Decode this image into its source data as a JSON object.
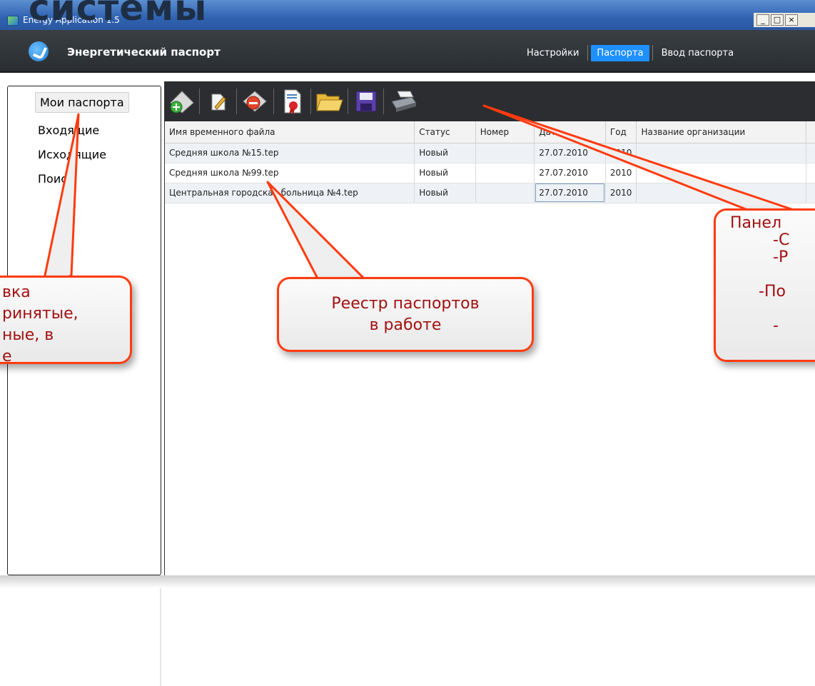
{
  "slide_title": "системы",
  "window": {
    "title": "Energy Application 1.5",
    "buttons": [
      "_",
      "□",
      "×"
    ]
  },
  "app": {
    "name": "Энергетический паспорт",
    "nav": [
      {
        "label": "Настройки",
        "active": false
      },
      {
        "label": "Паспорта",
        "active": true
      },
      {
        "label": "Ввод паспорта",
        "active": false
      }
    ]
  },
  "left_nav": {
    "items": [
      "Мои паспорта",
      "Входящие",
      "Исходящие",
      "Поиск"
    ],
    "selected": "Мои паспорта"
  },
  "toolbar": {
    "icons": [
      "add-icon",
      "edit-icon",
      "delete-icon",
      "certificate-icon",
      "open-folder-icon",
      "save-icon",
      "print-icon"
    ]
  },
  "grid": {
    "columns": [
      "Имя временного файла",
      "Статус",
      "Номер",
      "Дата",
      "Год",
      "Название организации",
      ""
    ],
    "rows": [
      [
        "Средняя школа №15.tep",
        "Новый",
        "",
        "27.07.2010",
        "2010",
        "",
        ""
      ],
      [
        "Средняя школа №99.tep",
        "Новый",
        "",
        "27.07.2010",
        "2010",
        "",
        ""
      ],
      [
        "Центральная городская больница №4.tep",
        "Новый",
        "",
        "27.07.2010",
        "2010",
        "",
        ""
      ]
    ]
  },
  "callouts": {
    "left": "вка\nринятые,\nные, в\nе",
    "center": "Реестр паспортов\nв работе",
    "right": "Панел\n-С\n-Р\n\n-По\n\n-"
  },
  "colors": {
    "accent": "#1e90ff",
    "callout_border": "#ff3b10",
    "callout_text": "#a11111",
    "header_bg": "#2b2d30"
  }
}
